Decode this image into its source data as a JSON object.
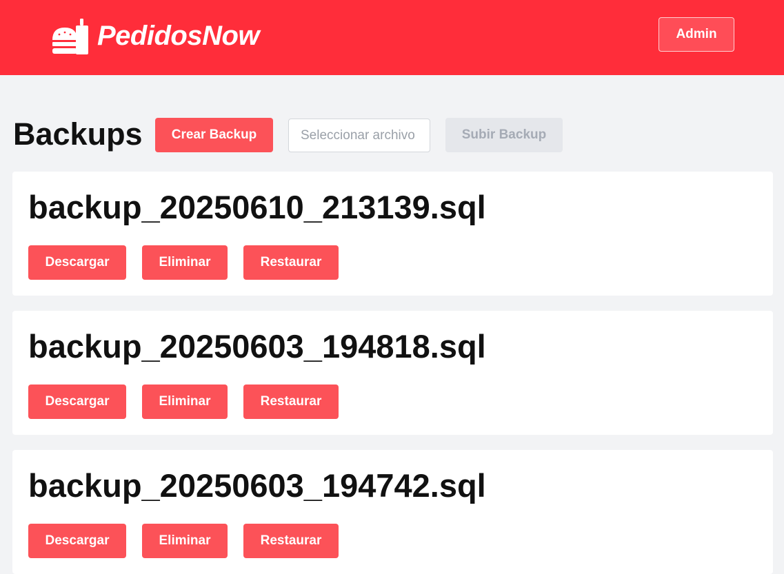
{
  "header": {
    "brand": "PedidosNow",
    "logo_icon": "burger-with-fork-icon",
    "admin_label": "Admin",
    "bg_color": "#ff2d3a"
  },
  "toolbar": {
    "title": "Backups",
    "create_label": "Crear Backup",
    "file_placeholder": "Seleccionar archivo",
    "upload_label": "Subir Backup"
  },
  "backups": [
    {
      "filename": "backup_20250610_213139.sql",
      "download_label": "Descargar",
      "delete_label": "Eliminar",
      "restore_label": "Restaurar"
    },
    {
      "filename": "backup_20250603_194818.sql",
      "download_label": "Descargar",
      "delete_label": "Eliminar",
      "restore_label": "Restaurar"
    },
    {
      "filename": "backup_20250603_194742.sql",
      "download_label": "Descargar",
      "delete_label": "Eliminar",
      "restore_label": "Restaurar"
    }
  ],
  "colors": {
    "accent": "#fc5258",
    "disabled_bg": "#e5e7eb",
    "page_bg": "#f2f3f5"
  }
}
